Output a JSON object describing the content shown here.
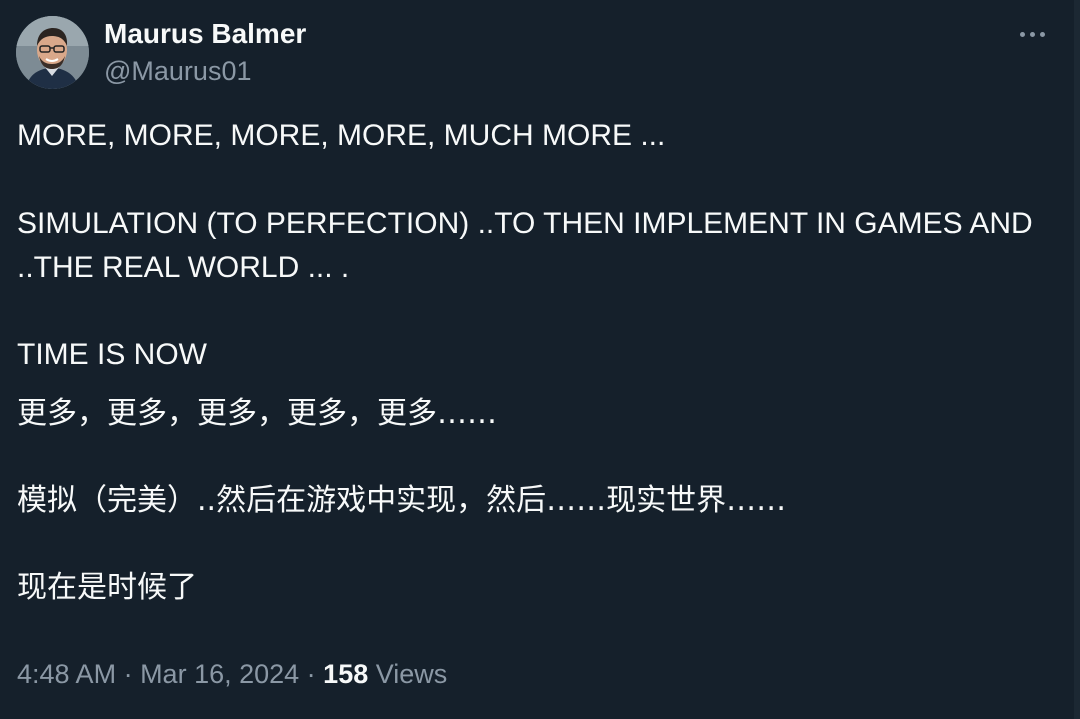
{
  "author": {
    "display_name": "Maurus Balmer",
    "handle": "@Maurus01",
    "avatar_icon": "profile-photo"
  },
  "menu": {
    "icon": "more-horizontal-icon"
  },
  "tweet": {
    "lines": [
      "MORE, MORE, MORE, MORE, MUCH MORE ...",
      "SIMULATION (TO PERFECTION) ..TO THEN IMPLEMENT IN GAMES AND",
      "..THE REAL WORLD ... .",
      "TIME IS NOW",
      "更多，更多，更多，更多，更多……",
      "模拟（完美）..然后在游戏中实现，然后……现实世界……",
      "现在是时候了"
    ]
  },
  "meta": {
    "time": "4:48 AM",
    "separator": " · ",
    "date": "Mar 16, 2024",
    "views_count": "158",
    "views_label": " Views"
  },
  "colors": {
    "background": "#15202b",
    "text_primary": "#f7f9f9",
    "text_secondary": "#8b98a5"
  }
}
